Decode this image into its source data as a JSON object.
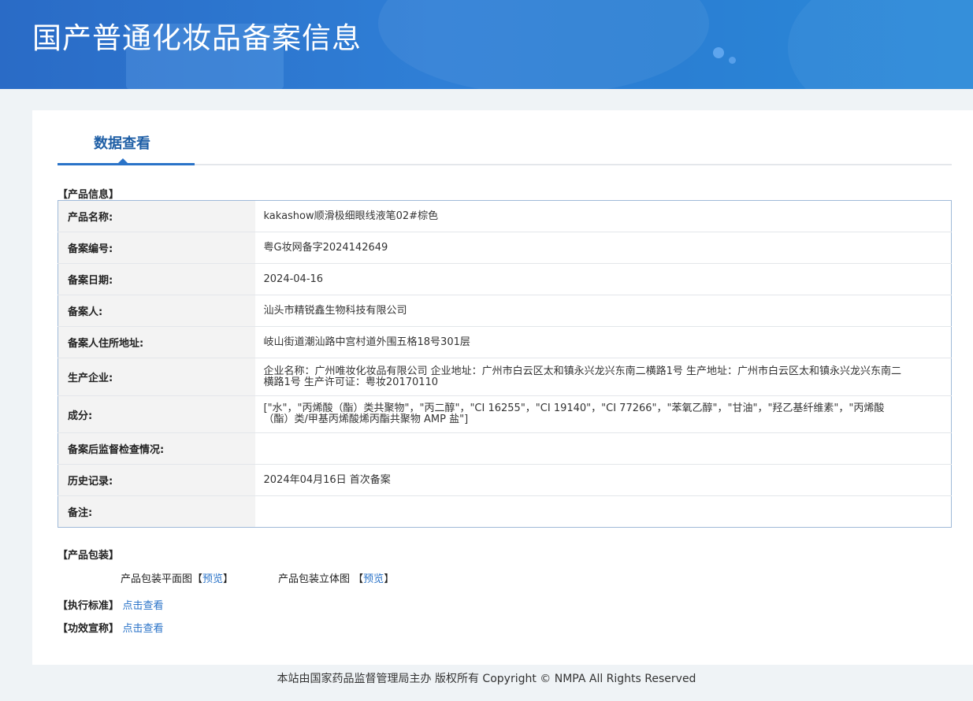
{
  "header": {
    "title": "国产普通化妆品备案信息"
  },
  "tabs": [
    {
      "label": "数据查看"
    }
  ],
  "product_info": {
    "section_title": "【产品信息】",
    "rows": [
      {
        "key": "产品名称:",
        "value": "kakashow顺滑极细眼线液笔02#棕色"
      },
      {
        "key": "备案编号:",
        "value": "粤G妆网备字2024142649"
      },
      {
        "key": "备案日期:",
        "value": "2024-04-16"
      },
      {
        "key": "备案人:",
        "value": "汕头市精锐鑫生物科技有限公司"
      },
      {
        "key": "备案人住所地址:",
        "value": "岐山街道潮汕路中宫村道外围五格18号301层"
      },
      {
        "key": "生产企业:",
        "value": "企业名称：广州唯妆化妆品有限公司 企业地址：广州市白云区太和镇永兴龙兴东南二横路1号 生产地址：广州市白云区太和镇永兴龙兴东南二横路1号 生产许可证：粤妆20170110"
      },
      {
        "key": "成分:",
        "value": "[\"水\"，\"丙烯酸（酯）类共聚物\"，\"丙二醇\"，\"CI 16255\"，\"CI 19140\"，\"CI 77266\"，\"苯氧乙醇\"，\"甘油\"，\"羟乙基纤维素\"，\"丙烯酸（酯）类/甲基丙烯酸烯丙酯共聚物 AMP 盐\"]"
      },
      {
        "key": "备案后监督检查情况:",
        "value": ""
      },
      {
        "key": "历史记录:",
        "value": "2024年04月16日 首次备案"
      },
      {
        "key": "备注:",
        "value": ""
      }
    ]
  },
  "packaging": {
    "section_title": "【产品包装】",
    "flat_label": "产品包装平面图",
    "flat_link": "预览",
    "solid_label": "产品包装立体图",
    "solid_link": "预览",
    "bracket_open": "【",
    "bracket_close": "】"
  },
  "standard": {
    "section_title": "【执行标准】",
    "link": "点击查看"
  },
  "efficacy": {
    "section_title": "【功效宣称】",
    "link": "点击查看"
  },
  "footer": {
    "text": "本站由国家药品监督管理局主办 版权所有 Copyright © NMPA All Rights Reserved"
  }
}
